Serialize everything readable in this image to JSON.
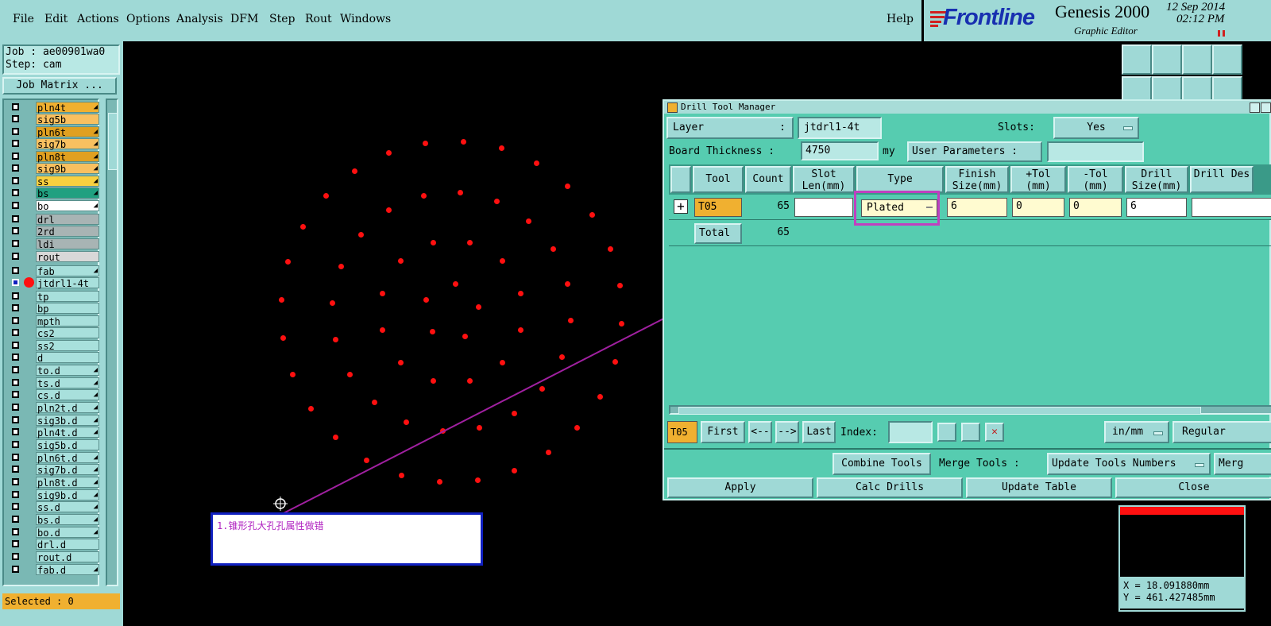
{
  "menu": [
    "File",
    "Edit",
    "Actions",
    "Options",
    "Analysis",
    "DFM",
    "Step",
    "Rout",
    "Windows"
  ],
  "help": "Help",
  "brand": {
    "logo": "Frontline",
    "product": "Genesis 2000",
    "subtitle": "Graphic Editor",
    "date": "12 Sep 2014",
    "time": "02:12 PM"
  },
  "job": {
    "job": "Job : ae00901wa0",
    "step": "Step: cam",
    "matrix_button": "Job Matrix ..."
  },
  "layers": [
    {
      "name": "pln4t",
      "color": "#f0b030"
    },
    {
      "name": "sig5b",
      "color": "#f8c060"
    },
    {
      "name": "pln6t",
      "color": "#e0a020"
    },
    {
      "name": "sig7b",
      "color": "#f8c060"
    },
    {
      "name": "pln8t",
      "color": "#e0a020"
    },
    {
      "name": "sig9b",
      "color": "#f8c060"
    },
    {
      "name": "ss",
      "color": "#f8d040"
    },
    {
      "name": "bs",
      "color": "#20a080"
    },
    {
      "name": "bo",
      "color": "#ffffff"
    },
    {
      "name": "drl",
      "color": "#a8b4b4"
    },
    {
      "name": "2rd",
      "color": "#a8b4b4"
    },
    {
      "name": "ldi",
      "color": "#a8b4b4"
    },
    {
      "name": "rout",
      "color": "#d8d8d8"
    },
    {
      "name": "fab",
      "color": "#a8e0dc"
    },
    {
      "name": "jtdrl1-4t",
      "color": "#a8e0dc"
    },
    {
      "name": "tp",
      "color": "#a8e0dc"
    },
    {
      "name": "bp",
      "color": "#a8e0dc"
    },
    {
      "name": "mpth",
      "color": "#a8e0dc"
    },
    {
      "name": "cs2",
      "color": "#a8e0dc"
    },
    {
      "name": "ss2",
      "color": "#a8e0dc"
    },
    {
      "name": "d",
      "color": "#a8e0dc"
    },
    {
      "name": "to.d",
      "color": "#a8e0dc"
    },
    {
      "name": "ts.d",
      "color": "#a8e0dc"
    },
    {
      "name": "cs.d",
      "color": "#a8e0dc"
    },
    {
      "name": "pln2t.d",
      "color": "#a8e0dc"
    },
    {
      "name": "sig3b.d",
      "color": "#a8e0dc"
    },
    {
      "name": "pln4t.d",
      "color": "#a8e0dc"
    },
    {
      "name": "sig5b.d",
      "color": "#a8e0dc"
    },
    {
      "name": "pln6t.d",
      "color": "#a8e0dc"
    },
    {
      "name": "sig7b.d",
      "color": "#a8e0dc"
    },
    {
      "name": "pln8t.d",
      "color": "#a8e0dc"
    },
    {
      "name": "sig9b.d",
      "color": "#a8e0dc"
    },
    {
      "name": "ss.d",
      "color": "#a8e0dc"
    },
    {
      "name": "bs.d",
      "color": "#a8e0dc"
    },
    {
      "name": "bo.d",
      "color": "#a8e0dc"
    },
    {
      "name": "drl.d",
      "color": "#a8e0dc"
    },
    {
      "name": "rout.d",
      "color": "#a8e0dc"
    },
    {
      "name": "fab.d",
      "color": "#a8e0dc"
    }
  ],
  "selected": "Selected : 0",
  "annotation": "1.锥形孔大孔孔属性做错",
  "dtm": {
    "title": "Drill Tool Manager",
    "layer_label": "Layer",
    "layer_colon": ":",
    "layer_value": "jtdrl1-4t",
    "slots_label": "Slots:",
    "slots_value": "Yes",
    "board_thickness_label": "Board Thickness :",
    "board_thickness_value": "4750",
    "board_thickness_unit": "my",
    "user_params_label": "User Parameters :",
    "headers": [
      "Tool",
      "Count",
      "Slot Len(mm)",
      "Type",
      "Finish Size(mm)",
      "+Tol (mm)",
      "-Tol (mm)",
      "Drill Size(mm)",
      "Drill Des"
    ],
    "row": {
      "tool": "T05",
      "count": "65",
      "type": "Plated",
      "finish": "6",
      "ptol": "0",
      "mtol": "0",
      "drill": "6"
    },
    "total_label": "Total",
    "total_count": "65",
    "nav": {
      "current": "T05",
      "first": "First",
      "prev": "<--",
      "next": "-->",
      "last": "Last",
      "index_label": "Index:",
      "units": "in/mm",
      "mode": "Regular"
    },
    "combine": "Combine Tools",
    "merge_label": "Merge Tools :",
    "update_numbers": "Update Tools Numbers",
    "merge_trunc": "Merg",
    "apply": "Apply",
    "calc": "Calc Drills",
    "update_table": "Update Table",
    "close": "Close"
  },
  "coords": {
    "x": "X = 18.091880mm",
    "y": "Y = 461.427485mm"
  },
  "colors": {
    "panel": "#9fd9d6",
    "dialog": "#56ccb0",
    "drill": "#ff1010",
    "highlight": "#c040c0",
    "annotation_border": "#1020c0"
  }
}
